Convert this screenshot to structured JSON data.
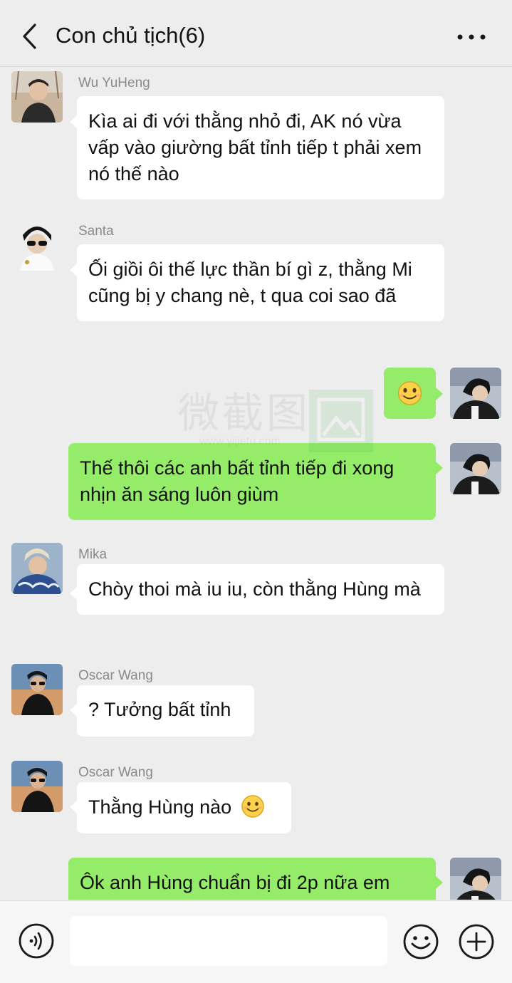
{
  "header": {
    "title": "Con chủ tịch(6)",
    "back_icon": "chevron-left-icon",
    "more_icon": "more-dots-icon"
  },
  "watermark": {
    "text": "微截图",
    "url": "www.yijietu.com"
  },
  "messages": [
    {
      "direction": "incoming",
      "sender": "Wu YuHeng",
      "text": "Kìa ai đi với thằng nhỏ đi, AK nó vừa vấp vào giường bất tỉnh tiếp t phải xem nó thế nào"
    },
    {
      "direction": "incoming",
      "sender": "Santa",
      "text": "Ối giồi ôi thế lực thần bí gì z, thằng Mi cũng bị y chang nè, t qua coi sao đã"
    },
    {
      "direction": "outgoing",
      "text": "",
      "emoji": "smile-emoji-icon"
    },
    {
      "direction": "outgoing",
      "text": "Thế thôi các anh bất tỉnh tiếp đi xong nhịn ăn sáng luôn giùm"
    },
    {
      "direction": "incoming",
      "sender": "Mika",
      "text": "Chòy thoi mà iu iu, còn thằng Hùng mà"
    },
    {
      "direction": "incoming",
      "sender": "Oscar Wang",
      "text": "? Tưởng bất tỉnh"
    },
    {
      "direction": "incoming",
      "sender": "Oscar Wang",
      "text": "Thằng Hùng nào",
      "emoji": "smile-emoji-icon"
    },
    {
      "direction": "outgoing",
      "text": "Ôk anh Hùng chuẩn bị đi 2p nữa em"
    }
  ],
  "footer": {
    "input_value": "",
    "voice_icon": "voice-icon",
    "emoji_icon": "emoji-icon",
    "plus_icon": "plus-icon"
  },
  "colors": {
    "background": "#ededed",
    "outgoing_bubble": "#95ec69",
    "incoming_bubble": "#ffffff",
    "sender_name": "#8a8a8a"
  }
}
